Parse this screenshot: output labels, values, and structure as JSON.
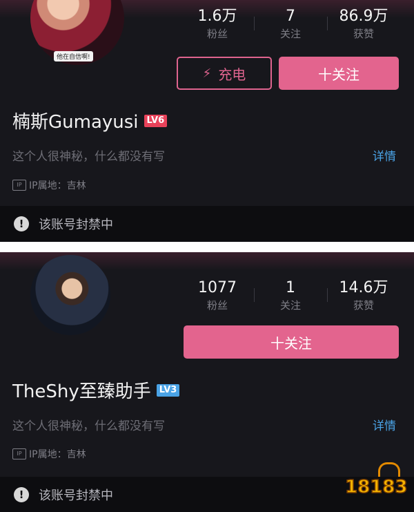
{
  "profile1": {
    "avatar_caption": "他在自信啊!",
    "stats": [
      {
        "value": "1.6万",
        "label": "粉丝"
      },
      {
        "value": "7",
        "label": "关注"
      },
      {
        "value": "86.9万",
        "label": "获赞"
      }
    ],
    "charge_label": "充电",
    "follow_label": "十关注",
    "username": "楠斯Gumayusi",
    "level": "LV6",
    "bio": "这个人很神秘，什么都没有写",
    "details_label": "详情",
    "ip_icon": "IP",
    "ip_text": "IP属地：吉林",
    "ban_text": "该账号封禁中"
  },
  "profile2": {
    "stats": [
      {
        "value": "1077",
        "label": "粉丝"
      },
      {
        "value": "1",
        "label": "关注"
      },
      {
        "value": "14.6万",
        "label": "获赞"
      }
    ],
    "follow_label": "十关注",
    "username": "TheShy至臻助手",
    "level": "LV3",
    "bio": "这个人很神秘，什么都没有写",
    "details_label": "详情",
    "ip_icon": "IP",
    "ip_text": "IP属地：吉林",
    "ban_text": "该账号封禁中"
  },
  "watermark": {
    "text": "18183"
  },
  "colors": {
    "accent": "#e3648e",
    "link": "#4aa3e6",
    "background": "#17171c"
  },
  "icons": {
    "charge": "lightning-icon",
    "ban": "alert-circle-icon",
    "ip": "ip-location-icon"
  }
}
